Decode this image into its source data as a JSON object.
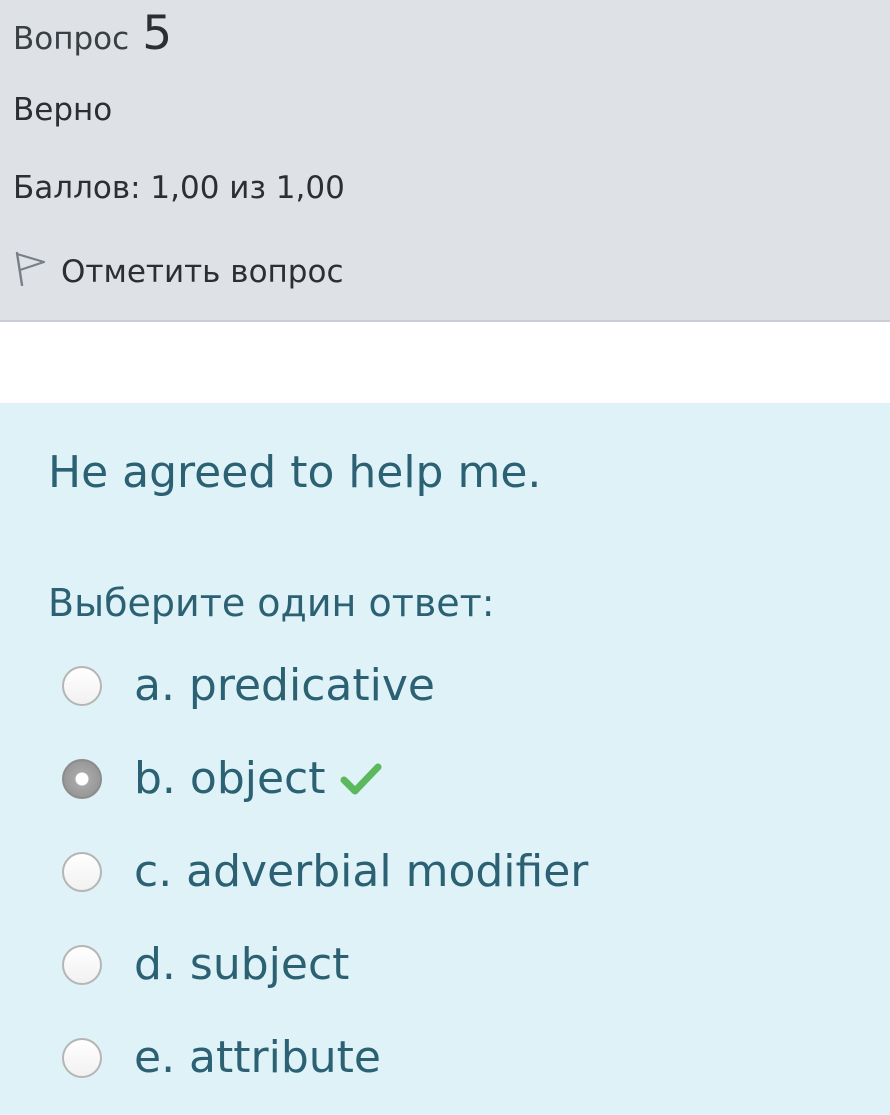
{
  "info": {
    "question_label": "Вопрос",
    "question_number": "5",
    "state": "Верно",
    "grade": "Баллов: 1,00 из 1,00",
    "flag_label": "Отметить вопрос"
  },
  "question": {
    "text": "He agreed to help me.",
    "prompt": "Выберите один ответ:",
    "answers": [
      {
        "label": "a. predicative",
        "checked": false,
        "correct": false
      },
      {
        "label": "b. object",
        "checked": true,
        "correct": true
      },
      {
        "label": "c. adverbial modifier",
        "checked": false,
        "correct": false
      },
      {
        "label": "d. subject",
        "checked": false,
        "correct": false
      },
      {
        "label": "e. attribute",
        "checked": false,
        "correct": false
      }
    ]
  },
  "icons": {
    "flag": "flag-outline-icon",
    "correct": "checkmark-icon"
  },
  "colors": {
    "info_bg": "#dee2e6",
    "content_bg": "#def2f8",
    "content_text": "#2b6173",
    "correct_check": "#5cb85c"
  }
}
